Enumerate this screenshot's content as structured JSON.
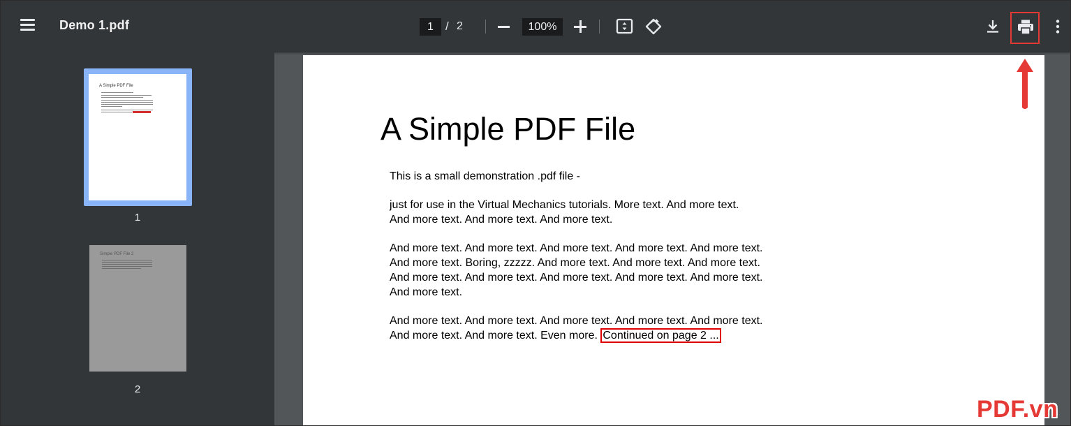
{
  "toolbar": {
    "file_name": "Demo 1.pdf",
    "current_page": "1",
    "page_separator": "/",
    "total_pages": "2",
    "zoom": "100%",
    "icons": [
      "menu-icon",
      "zoom-out-icon",
      "zoom-in-icon",
      "fit-page-icon",
      "rotate-icon",
      "download-icon",
      "print-icon",
      "more-options-icon"
    ]
  },
  "sidebar": {
    "thumbnails": [
      {
        "label": "1",
        "title": "A Simple PDF File",
        "selected": true
      },
      {
        "label": "2",
        "title": "Simple PDF File 2",
        "selected": false
      }
    ]
  },
  "document": {
    "title": "A Simple PDF File",
    "paragraphs": [
      "This is a small demonstration .pdf file -",
      "just for use in the Virtual Mechanics tutorials. More text. And more text. And more text. And more text. And more text.",
      "And more text. And more text. And more text. And more text. And more text. And more text. Boring, zzzzz. And more text. And more text. And more text. And more text. And more text. And more text. And more text. And more text. And more text.",
      "And more text. And more text. And more text. And more text. And more text. And more text. And more text. Even more."
    ],
    "continued_link": "Continued on page 2 ..."
  },
  "annotation": {
    "highlight_color": "#e53935",
    "watermark": "PDF.vn"
  }
}
